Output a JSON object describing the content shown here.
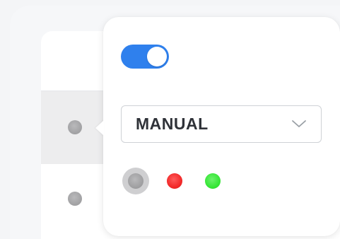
{
  "colors": {
    "toggle_on": "#2f80ed",
    "status_neutral": "#a4a4a6",
    "status_red": "#f22a2a",
    "status_green": "#37e637",
    "row_selected_bg": "#ededee"
  },
  "toggle": {
    "on": true
  },
  "mode_select": {
    "value": "MANUAL",
    "chevron_icon": "chevron-down-icon"
  },
  "status_options": [
    {
      "name": "neutral",
      "color": "#a4a4a6",
      "selected": true
    },
    {
      "name": "red",
      "color": "#f22a2a",
      "selected": false
    },
    {
      "name": "green",
      "color": "#37e637",
      "selected": false
    }
  ],
  "list_rows": [
    {
      "status": "neutral",
      "selected": true
    },
    {
      "status": "neutral",
      "selected": false
    }
  ]
}
